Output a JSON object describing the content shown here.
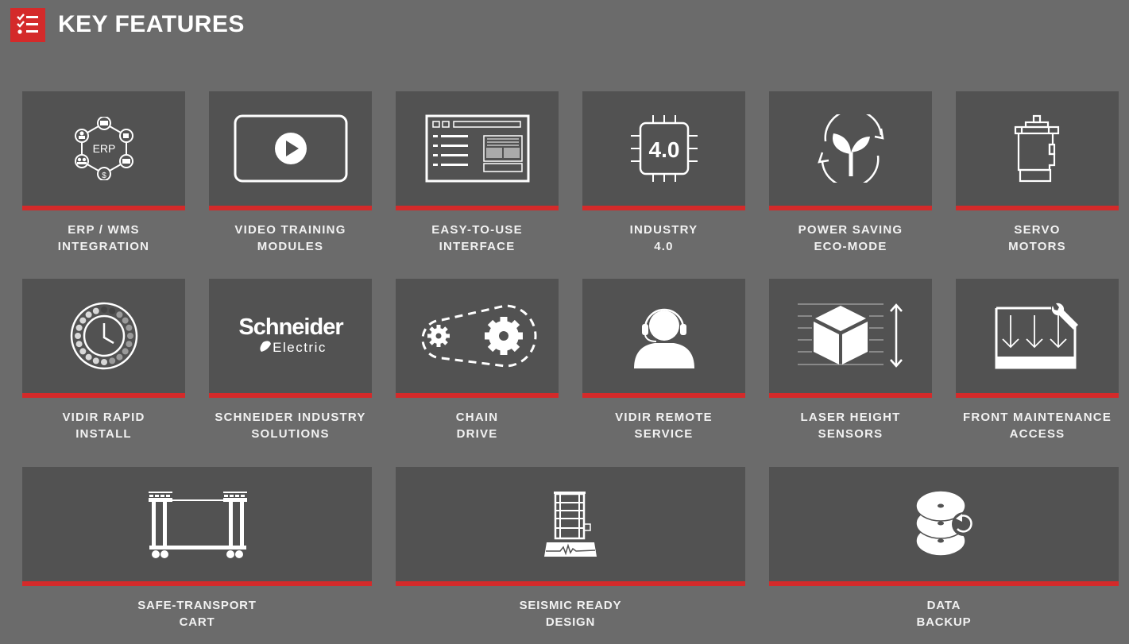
{
  "header": {
    "title": "KEY FEATURES",
    "icon": "checklist-icon"
  },
  "colors": {
    "background": "#6b6b6b",
    "card": "#525252",
    "accent": "#d42a2a",
    "text": "#f2f2f2"
  },
  "features": [
    {
      "icon": "erp-network-icon",
      "line1": "ERP / WMS",
      "line2": "INTEGRATION"
    },
    {
      "icon": "video-play-icon",
      "line1": "VIDEO TRAINING",
      "line2": "MODULES"
    },
    {
      "icon": "interface-window-icon",
      "line1": "EASY-TO-USE",
      "line2": "INTERFACE"
    },
    {
      "icon": "chip-icon",
      "icon_text": "4.0",
      "line1": "INDUSTRY",
      "line2": "4.0"
    },
    {
      "icon": "eco-leaf-cycle-icon",
      "line1": "POWER SAVING",
      "line2": "ECO-MODE"
    },
    {
      "icon": "servo-motor-icon",
      "line1": "SERVO",
      "line2": "MOTORS"
    },
    {
      "icon": "clock-dial-icon",
      "line1": "VIDIR RAPID",
      "line2": "INSTALL"
    },
    {
      "icon": "schneider-logo-icon",
      "icon_text": "Schneider",
      "icon_subtext": "Electric",
      "line1": "SCHNEIDER INDUSTRY",
      "line2": "SOLUTIONS"
    },
    {
      "icon": "chain-gears-icon",
      "line1": "CHAIN",
      "line2": "DRIVE"
    },
    {
      "icon": "headset-agent-icon",
      "line1": "VIDIR REMOTE",
      "line2": "SERVICE"
    },
    {
      "icon": "cube-height-icon",
      "line1": "LASER HEIGHT",
      "line2": "SENSORS"
    },
    {
      "icon": "maintenance-wrench-icon",
      "line1": "FRONT MAINTENANCE",
      "line2": "ACCESS"
    },
    {
      "icon": "transport-cart-icon",
      "line1": "SAFE-TRANSPORT",
      "line2": "CART"
    },
    {
      "icon": "seismic-cabinet-icon",
      "line1": "SEISMIC READY",
      "line2": "DESIGN"
    },
    {
      "icon": "disc-backup-icon",
      "line1": "DATA",
      "line2": "BACKUP"
    }
  ]
}
